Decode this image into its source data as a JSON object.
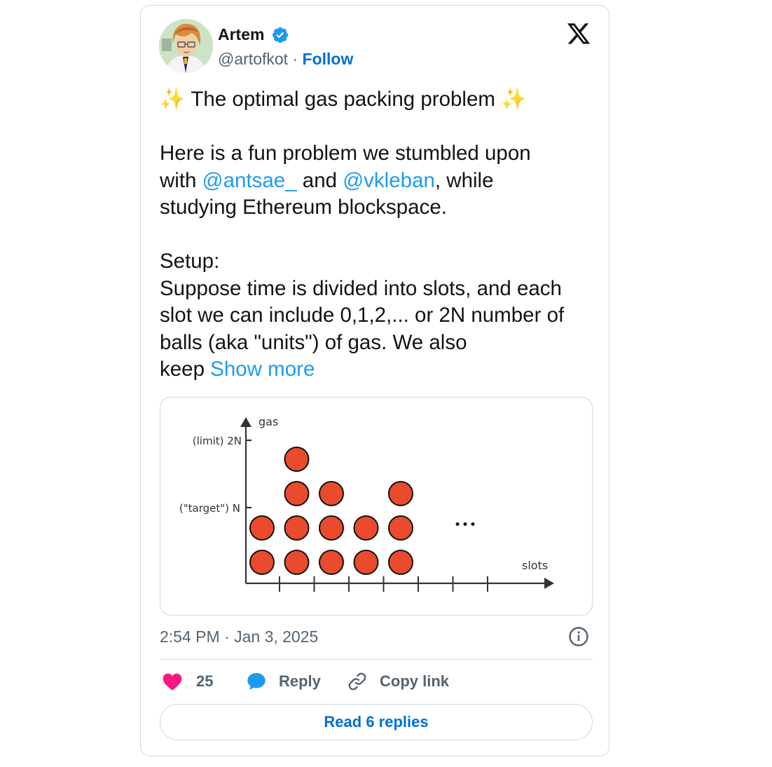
{
  "author": {
    "display_name": "Artem",
    "handle": "@artofkot",
    "separator": "·",
    "follow_label": "Follow",
    "verified": true
  },
  "tweet": {
    "title_line": "The optimal gas packing problem",
    "sparkle_emoji": "✨",
    "intro_1": "Here is a fun problem we stumbled upon",
    "intro_2_prefix": "with ",
    "mention_1": "@antsae_",
    "intro_2_mid": " and ",
    "mention_2": "@vkleban",
    "intro_2_suffix": ", while",
    "intro_3": "studying Ethereum blockspace.",
    "setup_label": "Setup:",
    "body_1": "Suppose time is divided into slots, and each",
    "body_2": "slot we can include 0,1,2,... or 2N number of",
    "body_3": "balls (aka \"units\") of gas. We also",
    "body_4": "keep ",
    "show_more_label": "Show more"
  },
  "diagram": {
    "y_axis_label": "gas",
    "x_axis_label": "slots",
    "limit_label": "(limit) 2N",
    "target_label": "(\"target\") N",
    "ellipsis": "•••",
    "balls_per_slot": [
      2,
      4,
      3,
      2,
      3
    ],
    "ball_color": "#e94b2c"
  },
  "meta": {
    "timestamp": "2:54 PM · Jan 3, 2025"
  },
  "actions": {
    "like_count": "25",
    "reply_label": "Reply",
    "copy_label": "Copy link",
    "read_replies_label": "Read 6 replies"
  },
  "colors": {
    "link": "#1d9bf0",
    "follow": "#006fd6",
    "like": "#f91880",
    "verified": "#1d9bf0"
  }
}
